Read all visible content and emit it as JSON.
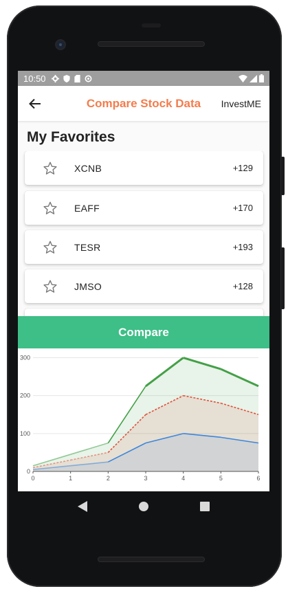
{
  "status": {
    "time": "10:50"
  },
  "appbar": {
    "title": "Compare Stock Data",
    "brand": "InvestME"
  },
  "favorites": {
    "heading": "My Favorites",
    "items": [
      {
        "symbol": "XCNB",
        "change": "+129"
      },
      {
        "symbol": "EAFF",
        "change": "+170"
      },
      {
        "symbol": "TESR",
        "change": "+193"
      },
      {
        "symbol": "JMSO",
        "change": "+128"
      }
    ]
  },
  "compare_label": "Compare",
  "colors": {
    "accent": "#f47c4c",
    "compare": "#3dbf87",
    "green": "#43a047",
    "red": "#e0503a",
    "blue": "#3d86dc"
  },
  "chart_data": {
    "type": "area",
    "x": [
      0,
      1,
      2,
      3,
      4,
      5,
      6
    ],
    "xticks": [
      "0",
      "1",
      "2",
      "3",
      "4",
      "5",
      "6"
    ],
    "yticks": [
      "0",
      "100",
      "200",
      "300"
    ],
    "ylim": [
      0,
      310
    ],
    "series": [
      {
        "color": "#43a047",
        "values": [
          15,
          45,
          75,
          225,
          300,
          270,
          225
        ]
      },
      {
        "color": "#e0503a",
        "values": [
          10,
          30,
          50,
          150,
          200,
          180,
          150
        ]
      },
      {
        "color": "#3d86dc",
        "values": [
          5,
          15,
          25,
          75,
          100,
          90,
          75
        ]
      }
    ]
  }
}
